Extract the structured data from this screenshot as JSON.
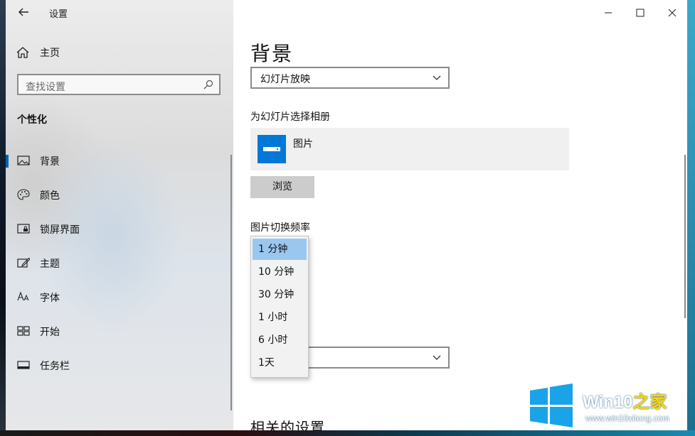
{
  "window": {
    "title": "设置",
    "controls": {
      "minimize": "minimize-icon",
      "maximize": "maximize-icon",
      "close": "close-icon"
    }
  },
  "nav": {
    "home_label": "主页",
    "search_placeholder": "查找设置",
    "section_title": "个性化",
    "items": [
      {
        "label": "背景",
        "icon": "picture-icon",
        "selected": true
      },
      {
        "label": "颜色",
        "icon": "palette-icon",
        "selected": false
      },
      {
        "label": "锁屏界面",
        "icon": "lock-screen-icon",
        "selected": false
      },
      {
        "label": "主题",
        "icon": "theme-icon",
        "selected": false
      },
      {
        "label": "字体",
        "icon": "font-icon",
        "selected": false
      },
      {
        "label": "开始",
        "icon": "start-icon",
        "selected": false
      },
      {
        "label": "任务栏",
        "icon": "taskbar-icon",
        "selected": false
      }
    ]
  },
  "main": {
    "title": "背景",
    "background_type_value": "幻灯片放映",
    "album_label": "为幻灯片选择相册",
    "album_name": "图片",
    "browse_label": "浏览",
    "interval_label": "图片切换频率",
    "interval_options": [
      "1 分钟",
      "10 分钟",
      "30 分钟",
      "1 小时",
      "6 小时",
      "1天"
    ],
    "interval_selected": "1 分钟",
    "related_title": "相关的设置"
  },
  "watermark": {
    "brand": "Win10",
    "brand_zh": "之家",
    "url": "www.win10xitong.com"
  },
  "colors": {
    "accent": "#0078d7",
    "selected_option": "#99c7ef",
    "button_gray": "#cccccc"
  }
}
